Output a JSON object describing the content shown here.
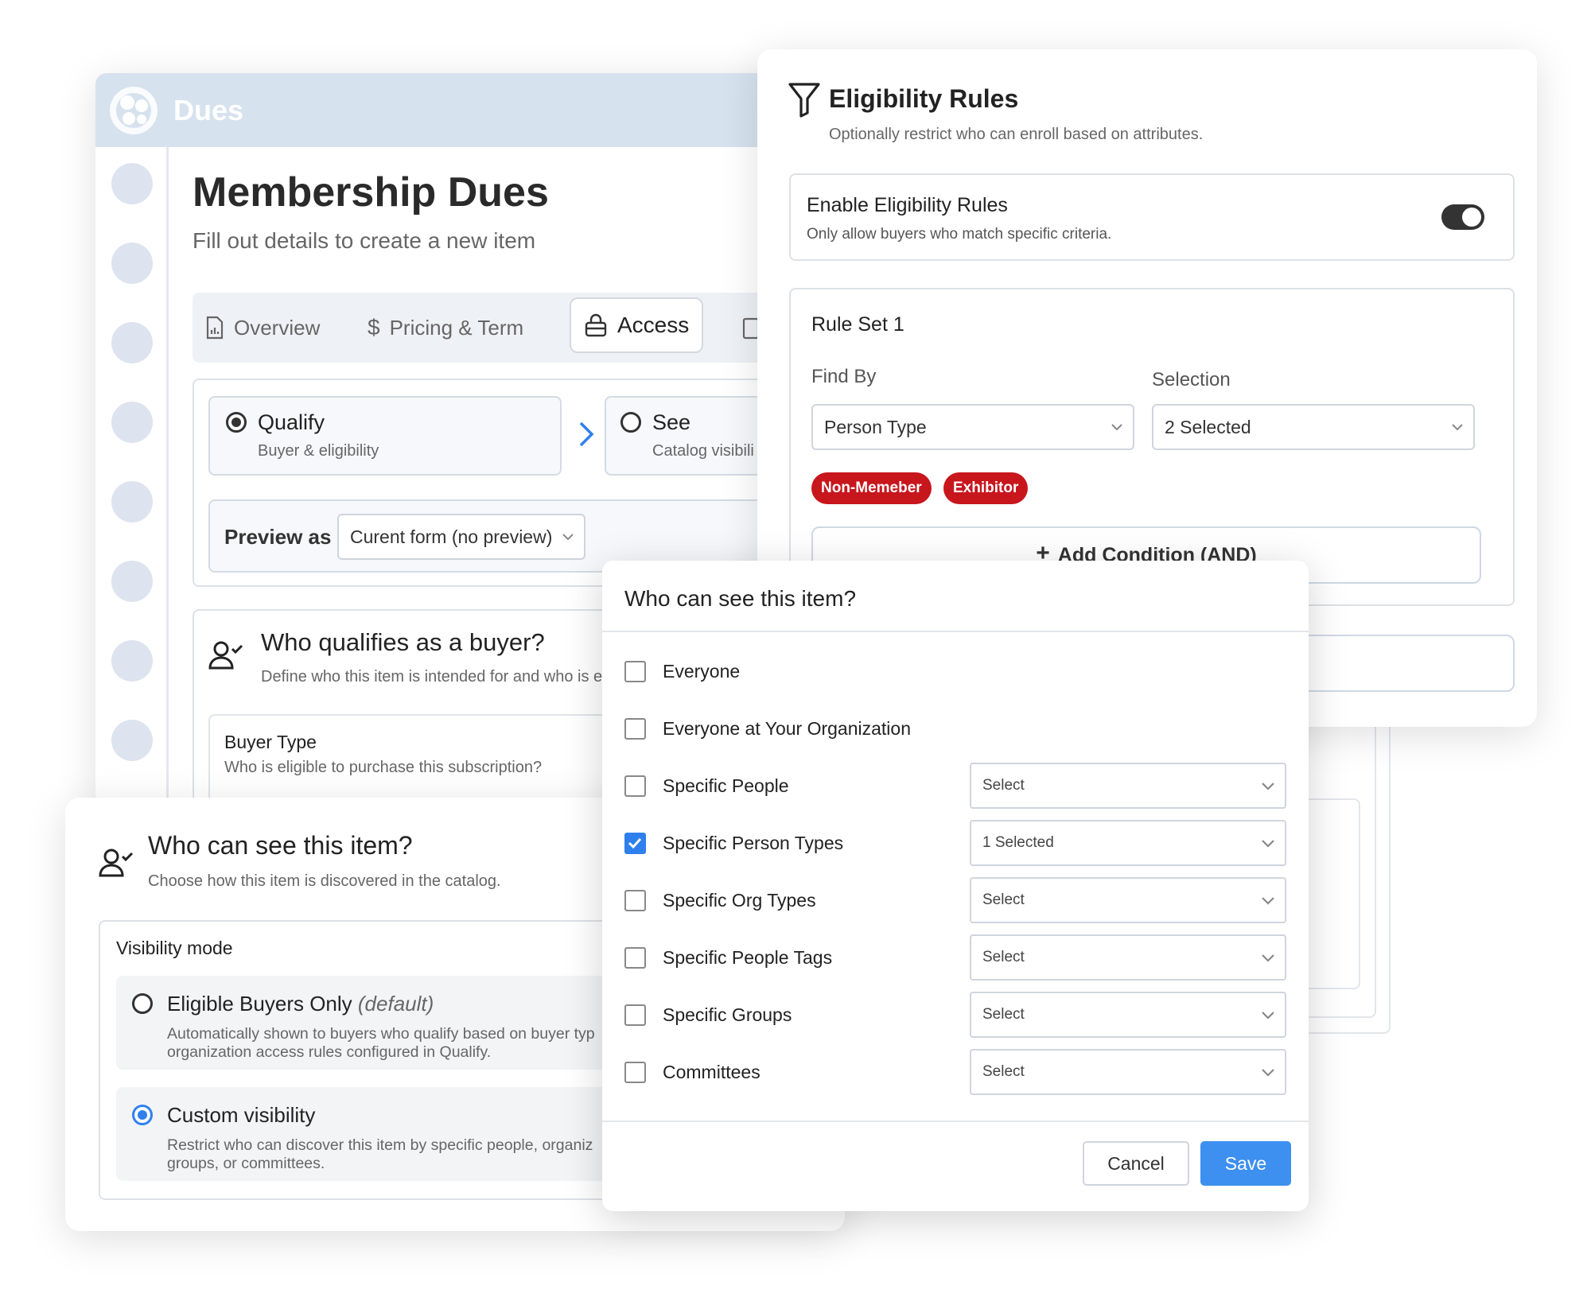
{
  "app": {
    "title": "Dues",
    "page_title": "Membership Dues",
    "page_subtitle": "Fill out details to create a new item",
    "tabs": [
      {
        "label": "Overview",
        "icon": "report-icon"
      },
      {
        "label": "Pricing & Term",
        "icon": "dollar-icon"
      },
      {
        "label": "Access",
        "icon": "lock-icon",
        "active": true
      }
    ],
    "steps": [
      {
        "title": "Qualify",
        "subtitle": "Buyer & eligibility",
        "selected": true
      },
      {
        "title": "See",
        "subtitle": "Catalog visibili",
        "selected": false
      }
    ],
    "preview": {
      "label": "Preview as",
      "value": "Curent form (no preview)"
    },
    "buyer": {
      "title": "Who qualifies as a buyer?",
      "subtitle": "Define who this item is intended for and who is e",
      "type_title": "Buyer Type",
      "type_subtitle": "Who is eligible to purchase this subscription?"
    }
  },
  "eligibility": {
    "title": "Eligibility Rules",
    "subtitle": "Optionally restrict who can enroll based on attributes.",
    "enable_title": "Enable Eligibility Rules",
    "enable_subtitle": "Only allow buyers who match specific criteria.",
    "enabled": true,
    "rule_set_title": "Rule Set 1",
    "find_by_label": "Find By",
    "selection_label": "Selection",
    "find_by_value": "Person Type",
    "selection_value": "2 Selected",
    "tags": [
      "Non-Memeber",
      "Exhibitor"
    ],
    "add_condition": "Add Condition (AND)",
    "tag_color": "#c8161d"
  },
  "visibility": {
    "title": "Who can see this item?",
    "subtitle": "Choose how this item is discovered in the catalog.",
    "mode_label": "Visibility mode",
    "options": [
      {
        "title": "Eligible Buyers Only",
        "suffix": "(default)",
        "line1": "Automatically shown to buyers who qualify based on buyer typ",
        "line2": "organization access rules configured in Qualify.",
        "selected": false
      },
      {
        "title": "Custom visibility",
        "suffix": "",
        "line1": "Restrict who can discover this item by specific people, organiz",
        "line2": "groups, or committees.",
        "selected": true
      }
    ]
  },
  "dialog": {
    "title": "Who can see this item?",
    "rows": [
      {
        "label": "Everyone",
        "checked": false,
        "select": null
      },
      {
        "label": "Everyone at Your Organization",
        "checked": false,
        "select": null
      },
      {
        "label": "Specific People",
        "checked": false,
        "select": "Select"
      },
      {
        "label": "Specific Person Types",
        "checked": true,
        "select": "1 Selected"
      },
      {
        "label": "Specific Org Types",
        "checked": false,
        "select": "Select"
      },
      {
        "label": "Specific People Tags",
        "checked": false,
        "select": "Select"
      },
      {
        "label": "Specific Groups",
        "checked": false,
        "select": "Select"
      },
      {
        "label": "Committees",
        "checked": false,
        "select": "Select"
      }
    ],
    "cancel": "Cancel",
    "save": "Save",
    "accent": "#2f80ed"
  }
}
